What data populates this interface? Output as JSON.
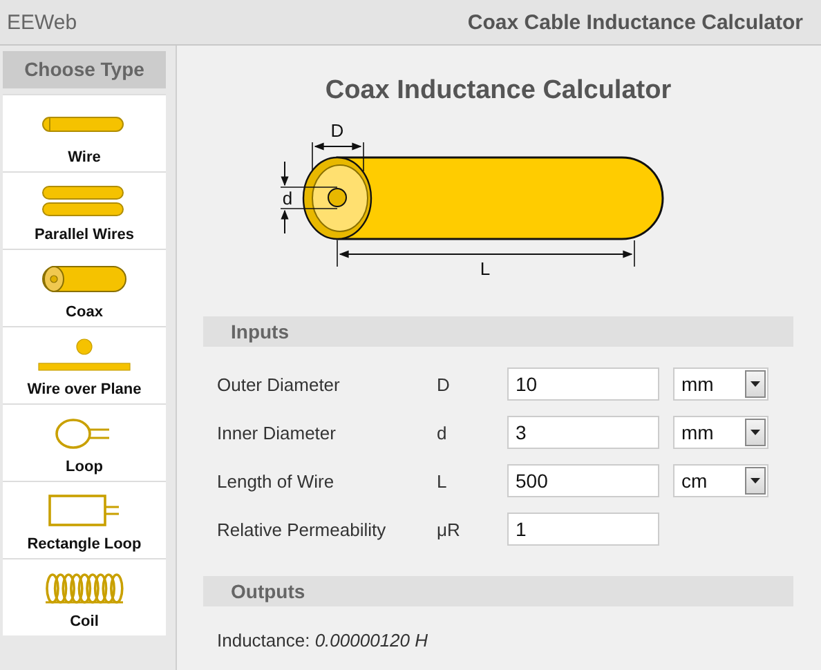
{
  "header": {
    "brand": "EEWeb",
    "title": "Coax Cable Inductance Calculator"
  },
  "sidebar": {
    "heading": "Choose Type",
    "items": [
      {
        "label": "Wire",
        "kind": "wire"
      },
      {
        "label": "Parallel Wires",
        "kind": "parallel"
      },
      {
        "label": "Coax",
        "kind": "coax"
      },
      {
        "label": "Wire over Plane",
        "kind": "plane"
      },
      {
        "label": "Loop",
        "kind": "loop"
      },
      {
        "label": "Rectangle Loop",
        "kind": "rectloop"
      },
      {
        "label": "Coil",
        "kind": "coil"
      }
    ]
  },
  "main": {
    "title": "Coax Inductance Calculator",
    "diagram": {
      "outer_label": "D",
      "inner_label": "d",
      "length_label": "L"
    },
    "inputs": {
      "heading": "Inputs",
      "rows": [
        {
          "label": "Outer Diameter",
          "symbol": "D",
          "value": "10",
          "unit": "mm"
        },
        {
          "label": "Inner Diameter",
          "symbol": "d",
          "value": "3",
          "unit": "mm"
        },
        {
          "label": "Length of Wire",
          "symbol": "L",
          "value": "500",
          "unit": "cm"
        },
        {
          "label": "Relative Permeability",
          "symbol": "μR",
          "value": "1"
        }
      ]
    },
    "outputs": {
      "heading": "Outputs",
      "result": "Inductance: *0.00000120 H*"
    }
  }
}
